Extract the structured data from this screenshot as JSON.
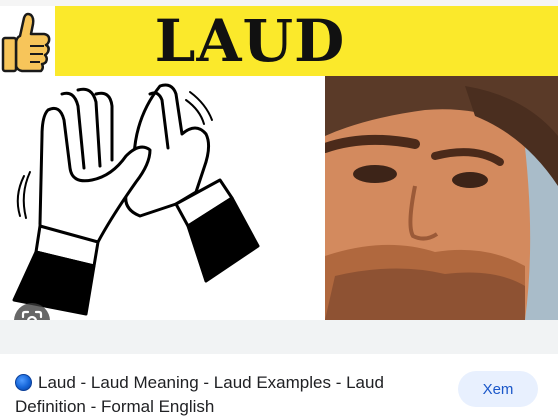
{
  "image_card": {
    "banner_text": "LAUD",
    "icons": {
      "thumb": "thumbs-up-icon",
      "clap": "clapping-hands-illustration",
      "lens": "google-lens-icon",
      "source": "site-favicon-icon"
    },
    "colors": {
      "banner_yellow": "#fbe92b",
      "button_bg": "#e8f0fe",
      "button_text": "#1a57c9"
    }
  },
  "result": {
    "title": "Laud - Laud Meaning - Laud Examples - Laud Definition - Formal English",
    "view_button_label": "Xem"
  }
}
